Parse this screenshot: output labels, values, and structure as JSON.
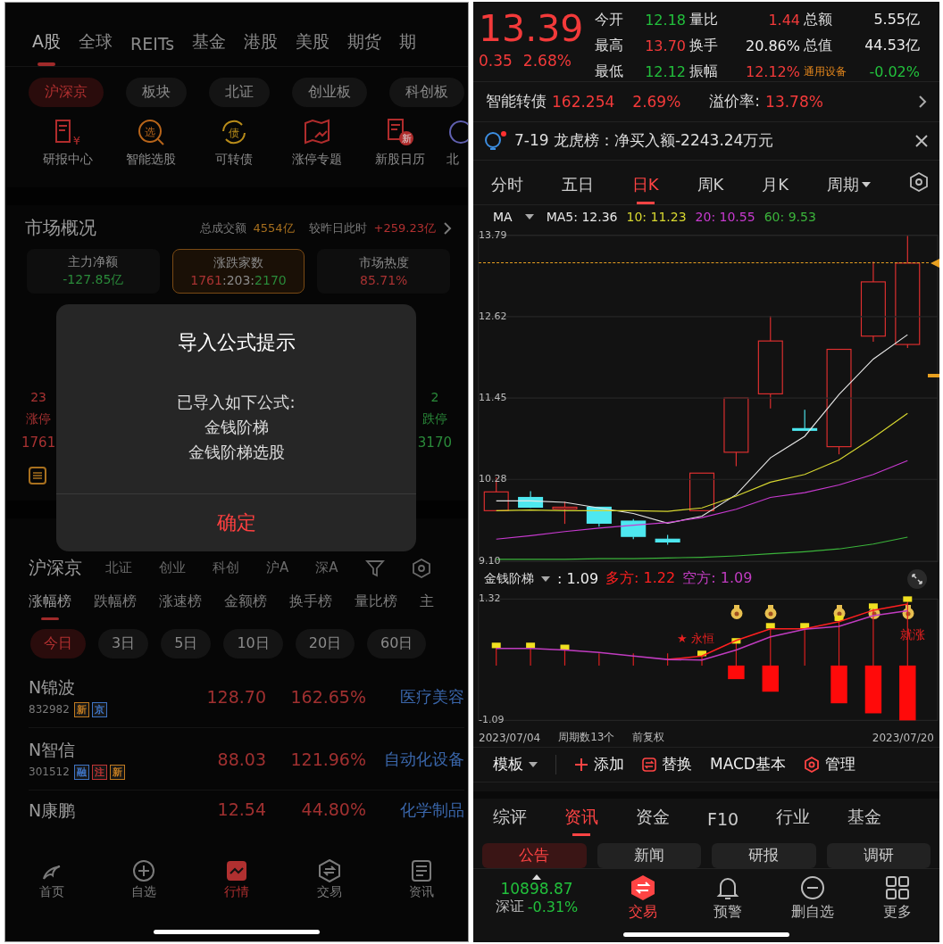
{
  "left_screen": {
    "market_tabs": [
      {
        "label": "A股",
        "selected": true
      },
      {
        "label": "全球",
        "selected": false
      },
      {
        "label": "REITs",
        "selected": false
      },
      {
        "label": "基金",
        "selected": false
      },
      {
        "label": "港股",
        "selected": false
      },
      {
        "label": "美股",
        "selected": false
      },
      {
        "label": "期货",
        "selected": false
      },
      {
        "label": "期",
        "selected": false
      }
    ],
    "market_chips": [
      {
        "label": "沪深京",
        "selected": true
      },
      {
        "label": "板块",
        "selected": false
      },
      {
        "label": "北证",
        "selected": false
      },
      {
        "label": "创业板",
        "selected": false
      },
      {
        "label": "科创板",
        "selected": false
      }
    ],
    "shortcuts": [
      {
        "label": "研报中心",
        "kind": "report",
        "icon_text": "¥"
      },
      {
        "label": "智能选股",
        "kind": "pick",
        "icon_text": "选"
      },
      {
        "label": "可转债",
        "kind": "bond",
        "icon_text": "债"
      },
      {
        "label": "涨停专题",
        "kind": "topic"
      },
      {
        "label": "新股日历",
        "kind": "ipo",
        "icon_text": "新"
      },
      {
        "label": "北",
        "kind": "partial"
      }
    ],
    "overview": {
      "title": "市场概况",
      "turnover_label": "总成交额",
      "turnover": "4554亿",
      "change_label": "较昨日此时",
      "change": "+259.23亿"
    },
    "overview_cards": [
      {
        "label": "主力净额",
        "selected": false,
        "parts": [
          {
            "text": "-127.85亿",
            "color": "#2a8a3a"
          }
        ]
      },
      {
        "label": "涨跌家数",
        "selected": true,
        "parts": [
          {
            "text": "1761",
            "color": "#a83232"
          },
          {
            "text": ":203:",
            "color": "#8a8a8a"
          },
          {
            "text": "2170",
            "color": "#2a8a3a"
          }
        ]
      },
      {
        "label": "市场热度",
        "selected": false,
        "parts": [
          {
            "text": "85.71%",
            "color": "#a83232"
          }
        ]
      }
    ],
    "limit_stats": [
      {
        "count": "23",
        "label": "涨停",
        "total": "1761",
        "color": "#a83232"
      },
      {
        "count": "2",
        "label": "跌停",
        "total": "3170",
        "color": "#2a8a3a"
      }
    ],
    "dialog": {
      "title": "导入公式提示",
      "message": "已导入如下公式:",
      "formulas": [
        "金钱阶梯",
        "金钱阶梯选股"
      ],
      "confirm": "确定"
    },
    "board_bar": {
      "title": "沪深京",
      "items": [
        "北证",
        "创业",
        "科创",
        "沪A",
        "深A"
      ]
    },
    "rank_tabs": [
      {
        "label": "涨幅榜",
        "selected": true
      },
      {
        "label": "跌幅榜",
        "selected": false
      },
      {
        "label": "涨速榜",
        "selected": false
      },
      {
        "label": "金额榜",
        "selected": false
      },
      {
        "label": "换手榜",
        "selected": false
      },
      {
        "label": "量比榜",
        "selected": false
      },
      {
        "label": "主",
        "selected": false
      }
    ],
    "period_chips": [
      {
        "label": "今日",
        "selected": true
      },
      {
        "label": "3日",
        "selected": false
      },
      {
        "label": "5日",
        "selected": false
      },
      {
        "label": "10日",
        "selected": false
      },
      {
        "label": "20日",
        "selected": false
      },
      {
        "label": "60日",
        "selected": false
      }
    ],
    "stocks": [
      {
        "name": "N锦波",
        "code": "832982",
        "tags": [
          {
            "text": "新",
            "color": "#c07a20"
          },
          {
            "text": "京",
            "color": "#3f74c4"
          }
        ],
        "price": "128.70",
        "change": "162.65%",
        "industry": "医疗美容"
      },
      {
        "name": "N智信",
        "code": "301512",
        "tags": [
          {
            "text": "融",
            "color": "#3f74c4"
          },
          {
            "text": "注",
            "color": "#c03434"
          },
          {
            "text": "新",
            "color": "#c07a20"
          }
        ],
        "price": "88.03",
        "change": "121.96%",
        "industry": "自动化设备"
      },
      {
        "name": "N康鹏",
        "price": "12.54",
        "change": "44.80%",
        "industry": "化学制品"
      }
    ],
    "nav": [
      {
        "label": "首页",
        "kind": "home",
        "selected": false
      },
      {
        "label": "自选",
        "kind": "add",
        "selected": false
      },
      {
        "label": "行情",
        "kind": "market",
        "selected": true
      },
      {
        "label": "交易",
        "kind": "trade",
        "selected": false
      },
      {
        "label": "资讯",
        "kind": "news",
        "selected": false
      }
    ]
  },
  "right_screen": {
    "quote": {
      "price": "13.39",
      "change": "0.35",
      "change_pct": "2.68%",
      "stats": [
        {
          "label": "今开",
          "value": "12.18",
          "color": "#22c03c"
        },
        {
          "label": "量比",
          "value": "1.44",
          "color": "#f33a3a"
        },
        {
          "label": "总额",
          "value": "5.55亿",
          "color": "#eeeeee"
        },
        {
          "label": "最高",
          "value": "13.70",
          "color": "#f33a3a"
        },
        {
          "label": "换手",
          "value": "20.86%",
          "color": "#eeeeee"
        },
        {
          "label": "总值",
          "value": "44.53亿",
          "color": "#eeeeee"
        },
        {
          "label": "最低",
          "value": "12.12",
          "color": "#22c03c"
        },
        {
          "label": "振幅",
          "value": "12.12%",
          "color": "#f33a3a"
        },
        {
          "label": "通用设备",
          "value": "-0.02%",
          "color": "#22c03c",
          "kind": "sector"
        }
      ]
    },
    "bond": {
      "label": "智能转债",
      "price": "162.254",
      "change": "2.69%",
      "premium_label": "溢价率:",
      "premium": "13.78%"
    },
    "notice": {
      "text": "7-19 龙虎榜：净买入额-2243.24万元",
      "unread": true
    },
    "chart_tabs": [
      {
        "label": "分时",
        "selected": false
      },
      {
        "label": "五日",
        "selected": false
      },
      {
        "label": "日K",
        "selected": true
      },
      {
        "label": "周K",
        "selected": false
      },
      {
        "label": "月K",
        "selected": false
      },
      {
        "label": "周期",
        "selected": false,
        "kind": "dropdown"
      }
    ],
    "ma_legend": {
      "label": "MA",
      "values": [
        ": 12.36",
        ": 11.23",
        ": 10.55",
        ": 9.53"
      ]
    },
    "chart_data": {
      "type": "line",
      "ylim": [
        9.1,
        13.79
      ],
      "grid": true,
      "yticks": [
        {
          "value": 13.79,
          "label": "13.79"
        },
        {
          "value": 12.62,
          "label": "12.62"
        },
        {
          "value": 11.45,
          "label": "11.45"
        },
        {
          "value": 10.28,
          "label": "10.28"
        },
        {
          "value": 9.1,
          "label": "9.10"
        }
      ],
      "series": [
        {
          "name": "MA5",
          "color": "#e6e6e6",
          "values": [
            9.97,
            9.97,
            9.95,
            9.87,
            9.79,
            9.65,
            9.75,
            10.06,
            10.59,
            10.9,
            11.5,
            12.01,
            12.36
          ]
        },
        {
          "name": "10",
          "color": "#d8d830",
          "values": [
            9.83,
            9.84,
            9.83,
            9.83,
            9.83,
            9.82,
            9.87,
            10.04,
            10.24,
            10.35,
            10.56,
            10.88,
            11.23
          ]
        },
        {
          "name": "20",
          "color": "#c83ad0",
          "values": [
            9.42,
            9.47,
            9.53,
            9.58,
            9.62,
            9.66,
            9.73,
            9.85,
            10.02,
            10.09,
            10.2,
            10.35,
            10.55
          ]
        },
        {
          "name": "60",
          "color": "#3bb43b",
          "values": [
            9.13,
            9.13,
            9.13,
            9.14,
            9.14,
            9.15,
            9.16,
            9.18,
            9.21,
            9.24,
            9.28,
            9.35,
            9.45
          ]
        }
      ]
    },
    "indicator": {
      "name": "金钱阶梯",
      "value": ": 1.09",
      "legend_values": [
        ": 1.22",
        ": 1.09"
      ],
      "signal_texts": [
        "★ 永恒",
        "就涨"
      ],
      "chart_data": {
        "type": "line",
        "ylim": [
          -1.09,
          1.32
        ],
        "yticks": [
          {
            "value": 1.32,
            "label": "1.32"
          },
          {
            "value": -1.09,
            "label": "-1.09"
          }
        ],
        "series": [
          {
            "name": "多方",
            "color": "#ff2020",
            "values": [
              null,
              null,
              null,
              null,
              null,
              0.12,
              0.19,
              0.5,
              0.73,
              0.73,
              0.87,
              1.1,
              1.22
            ]
          },
          {
            "name": "空方",
            "color": "#c03cc0",
            "values": [
              0.34,
              0.34,
              0.31,
              0.26,
              0.19,
              0.12,
              0.11,
              0.31,
              0.57,
              0.72,
              0.78,
              0.99,
              1.09
            ]
          },
          {
            "type": "bar",
            "color": "#ff0a0a",
            "values": [
              null,
              null,
              null,
              null,
              null,
              null,
              null,
              -0.27,
              -0.52,
              null,
              -0.75,
              -0.95,
              -1.09
            ]
          },
          {
            "type": "scatter",
            "marker": "square",
            "color": "#f0e020",
            "values": [
              0.4,
              0.4,
              0.36,
              null,
              null,
              null,
              0.24,
              0.49,
              0.79,
              0.79,
              0.94,
              1.18,
              1.32
            ]
          }
        ]
      }
    },
    "date_row": {
      "start": "2023/07/04",
      "periods": "周期数13个",
      "adjust": "前复权",
      "end": "2023/07/20"
    },
    "toolbar": [
      {
        "label": "模板",
        "kind": "dropdown"
      },
      {
        "label": "添加",
        "kind": "add"
      },
      {
        "label": "替换",
        "kind": "replace"
      },
      {
        "label": "MACD基本",
        "kind": "plain"
      },
      {
        "label": "管理",
        "kind": "manage"
      }
    ],
    "info_tabs": [
      {
        "label": "综评",
        "selected": false
      },
      {
        "label": "资讯",
        "selected": true
      },
      {
        "label": "资金",
        "selected": false
      },
      {
        "label": "F10",
        "selected": false
      },
      {
        "label": "行业",
        "selected": false
      },
      {
        "label": "基金",
        "selected": false
      }
    ],
    "info_chips": [
      {
        "label": "公告",
        "selected": true
      },
      {
        "label": "新闻",
        "selected": false
      },
      {
        "label": "研报",
        "selected": false
      },
      {
        "label": "调研",
        "selected": false
      }
    ],
    "index": {
      "value": "10898.87",
      "name": "深证",
      "change": "-0.31%"
    },
    "actions": [
      {
        "label": "交易",
        "kind": "trade",
        "selected": true
      },
      {
        "label": "预警",
        "kind": "alert",
        "selected": false
      },
      {
        "label": "删自选",
        "kind": "remove",
        "selected": false
      },
      {
        "label": "更多",
        "kind": "more",
        "selected": false
      }
    ]
  }
}
